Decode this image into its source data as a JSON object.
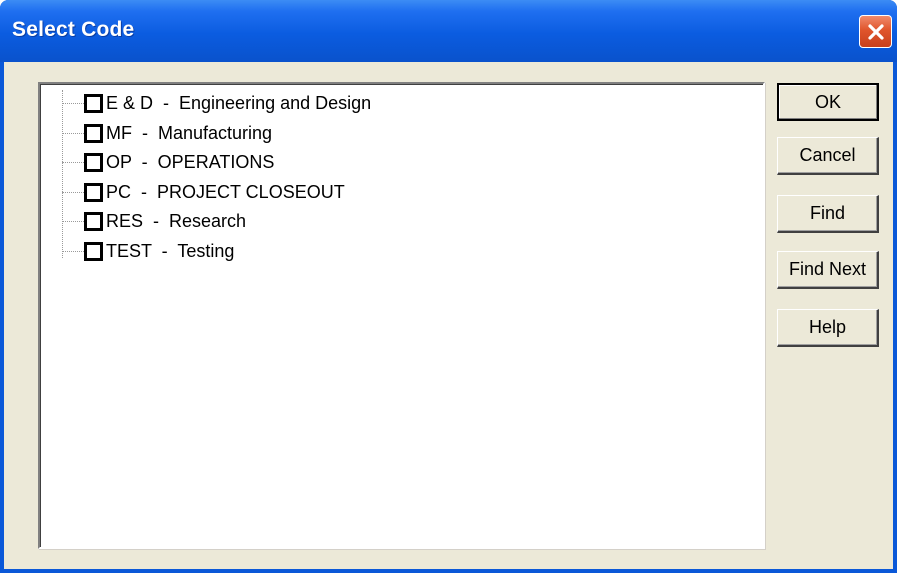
{
  "window": {
    "title": "Select Code",
    "close_icon": "close-icon"
  },
  "tree": {
    "items": [
      {
        "label": "E & D  -  Engineering and Design",
        "checked": false
      },
      {
        "label": "MF  -  Manufacturing",
        "checked": false
      },
      {
        "label": "OP  -  OPERATIONS",
        "checked": false
      },
      {
        "label": "PC  -  PROJECT CLOSEOUT",
        "checked": false
      },
      {
        "label": "RES  -  Research",
        "checked": false
      },
      {
        "label": "TEST  -  Testing",
        "checked": false
      }
    ]
  },
  "buttons": {
    "ok": "OK",
    "cancel": "Cancel",
    "find": "Find",
    "find_next": "Find Next",
    "help": "Help"
  },
  "colors": {
    "titlebar": "#0b5ce0",
    "close_button": "#e0552c",
    "dialog_face": "#ece9d8"
  }
}
